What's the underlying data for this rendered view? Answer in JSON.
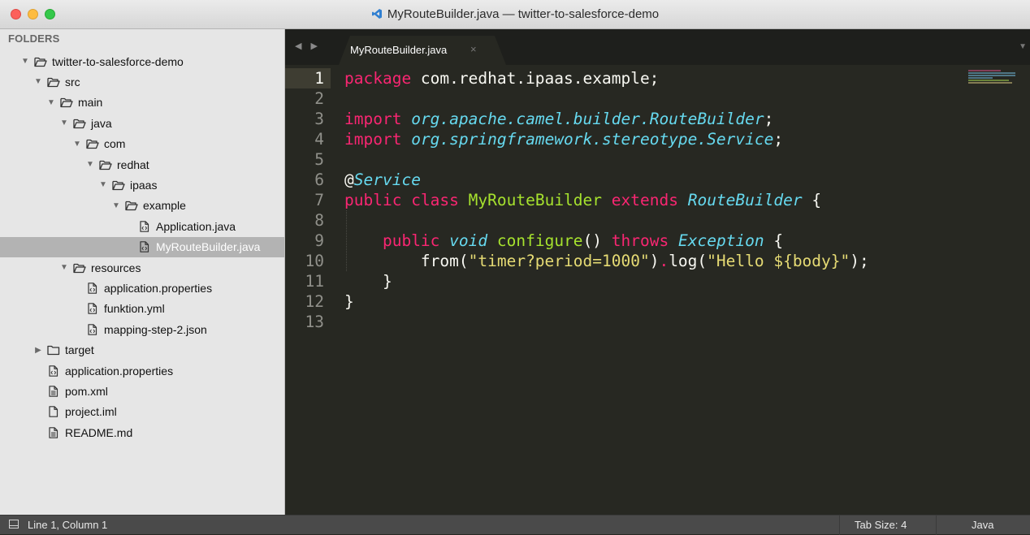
{
  "window": {
    "title": "MyRouteBuilder.java — twitter-to-salesforce-demo"
  },
  "sidebar": {
    "heading": "FOLDERS",
    "tree": [
      {
        "label": "twitter-to-salesforce-demo",
        "type": "folder-open",
        "depth": 0
      },
      {
        "label": "src",
        "type": "folder-open",
        "depth": 1
      },
      {
        "label": "main",
        "type": "folder-open",
        "depth": 2
      },
      {
        "label": "java",
        "type": "folder-open",
        "depth": 3
      },
      {
        "label": "com",
        "type": "folder-open",
        "depth": 4
      },
      {
        "label": "redhat",
        "type": "folder-open",
        "depth": 5
      },
      {
        "label": "ipaas",
        "type": "folder-open",
        "depth": 6
      },
      {
        "label": "example",
        "type": "folder-open",
        "depth": 7
      },
      {
        "label": "Application.java",
        "type": "file-code",
        "depth": 8
      },
      {
        "label": "MyRouteBuilder.java",
        "type": "file-code",
        "depth": 8,
        "selected": true
      },
      {
        "label": "resources",
        "type": "folder-open",
        "depth": 3
      },
      {
        "label": "application.properties",
        "type": "file-code",
        "depth": 4
      },
      {
        "label": "funktion.yml",
        "type": "file-code",
        "depth": 4
      },
      {
        "label": "mapping-step-2.json",
        "type": "file-code",
        "depth": 4
      },
      {
        "label": "target",
        "type": "folder-closed",
        "depth": 1
      },
      {
        "label": "application.properties",
        "type": "file-code",
        "depth": 1
      },
      {
        "label": "pom.xml",
        "type": "file-text",
        "depth": 1
      },
      {
        "label": "project.iml",
        "type": "file",
        "depth": 1
      },
      {
        "label": "README.md",
        "type": "file-text",
        "depth": 1
      }
    ]
  },
  "tabs": {
    "nav_arrows": "◀ ▶",
    "active_tab": "MyRouteBuilder.java",
    "close_glyph": "×",
    "menu_glyph": "▼"
  },
  "editor": {
    "line_numbers": [
      "1",
      "2",
      "3",
      "4",
      "5",
      "6",
      "7",
      "8",
      "9",
      "10",
      "11",
      "12",
      "13"
    ],
    "current_line": 1,
    "code": [
      [
        {
          "t": "kw",
          "v": "package"
        },
        {
          "t": "pl",
          "v": " com.redhat.ipaas.example;"
        }
      ],
      [],
      [
        {
          "t": "kw",
          "v": "import"
        },
        {
          "t": "pl",
          "v": " "
        },
        {
          "t": "ty",
          "v": "org.apache.camel.builder.RouteBuilder"
        },
        {
          "t": "pl",
          "v": ";"
        }
      ],
      [
        {
          "t": "kw",
          "v": "import"
        },
        {
          "t": "pl",
          "v": " "
        },
        {
          "t": "ty",
          "v": "org.springframework.stereotype.Service"
        },
        {
          "t": "pl",
          "v": ";"
        }
      ],
      [],
      [
        {
          "t": "pl",
          "v": "@"
        },
        {
          "t": "ty",
          "v": "Service"
        }
      ],
      [
        {
          "t": "kw",
          "v": "public"
        },
        {
          "t": "pl",
          "v": " "
        },
        {
          "t": "kw",
          "v": "class"
        },
        {
          "t": "pl",
          "v": " "
        },
        {
          "t": "cls",
          "v": "MyRouteBuilder"
        },
        {
          "t": "pl",
          "v": " "
        },
        {
          "t": "kw",
          "v": "extends"
        },
        {
          "t": "pl",
          "v": " "
        },
        {
          "t": "ty",
          "v": "RouteBuilder"
        },
        {
          "t": "pl",
          "v": " {"
        }
      ],
      [],
      [
        {
          "t": "pl",
          "v": "    "
        },
        {
          "t": "kw",
          "v": "public"
        },
        {
          "t": "pl",
          "v": " "
        },
        {
          "t": "ty",
          "v": "void"
        },
        {
          "t": "pl",
          "v": " "
        },
        {
          "t": "fn",
          "v": "configure"
        },
        {
          "t": "pl",
          "v": "() "
        },
        {
          "t": "kw",
          "v": "throws"
        },
        {
          "t": "pl",
          "v": " "
        },
        {
          "t": "ty",
          "v": "Exception"
        },
        {
          "t": "pl",
          "v": " {"
        }
      ],
      [
        {
          "t": "pl",
          "v": "        from("
        },
        {
          "t": "str",
          "v": "\"timer?period=1000\""
        },
        {
          "t": "pl",
          "v": ")"
        },
        {
          "t": "kw",
          "v": "."
        },
        {
          "t": "pl",
          "v": "log("
        },
        {
          "t": "str",
          "v": "\"Hello ${body}\""
        },
        {
          "t": "pl",
          "v": ");"
        }
      ],
      [
        {
          "t": "pl",
          "v": "    }"
        }
      ],
      [
        {
          "t": "pl",
          "v": "}"
        }
      ],
      []
    ]
  },
  "statusbar": {
    "position": "Line 1, Column 1",
    "tab_size": "Tab Size: 4",
    "syntax": "Java"
  },
  "colors": {
    "editor_bg": "#272822",
    "keyword": "#f92672",
    "type": "#66d9ef",
    "function": "#a6e22e",
    "string": "#e6db74",
    "sidebar_bg": "#e6e6e6",
    "sidebar_selected": "#b3b3b3"
  }
}
